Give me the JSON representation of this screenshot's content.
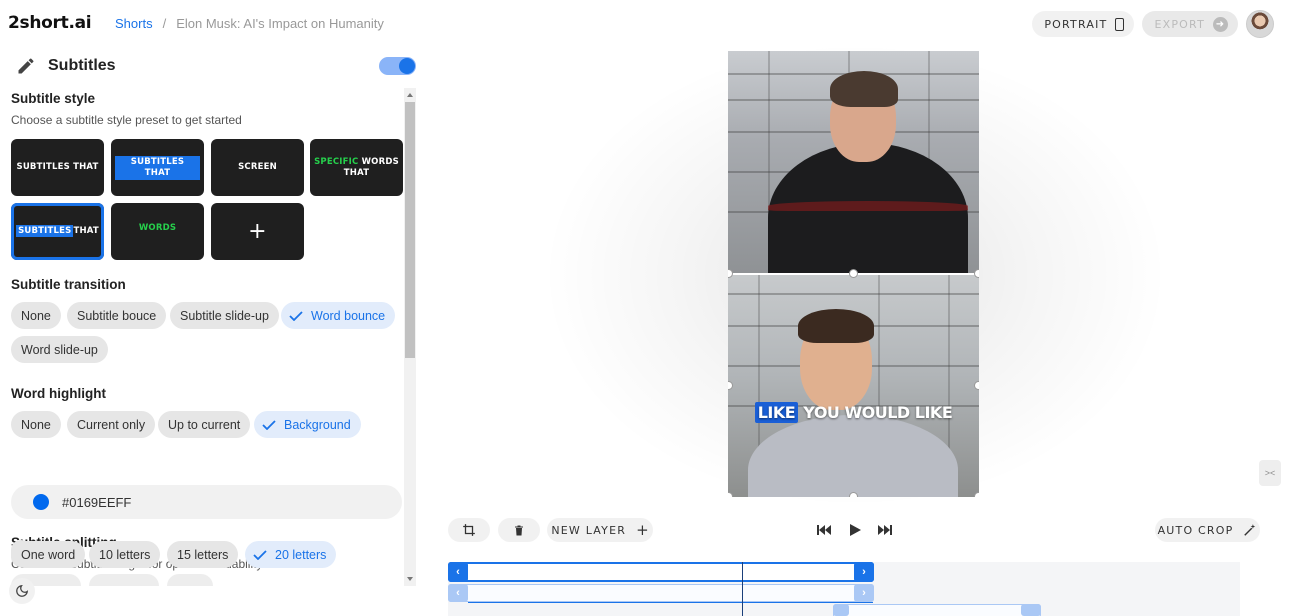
{
  "header": {
    "logo": "2short.ai",
    "breadcrumb": {
      "parent": "Shorts",
      "separator": "/",
      "current": "Elon Musk: AI's Impact on Humanity"
    },
    "portrait_label": "PORTRAIT",
    "export_label": "EXPORT"
  },
  "panel": {
    "title": "Subtitles",
    "toggle_on": true,
    "style": {
      "title": "Subtitle style",
      "subtitle": "Choose a subtitle style preset to get started",
      "presets": [
        {
          "text": "SUBTITLES THAT"
        },
        {
          "text": "SUBTITLES THAT"
        },
        {
          "text": "SCREEN"
        },
        {
          "highlight": "SPECIFIC",
          "text": "WORDS THAT"
        },
        {
          "highlight": "SUBTITLES",
          "text": "THAT",
          "selected": true
        },
        {
          "text": "WORDS"
        },
        {
          "text": "+"
        }
      ]
    },
    "transition": {
      "title": "Subtitle transition",
      "options": [
        "None",
        "Subtitle bouce",
        "Subtitle slide-up",
        "Word bounce",
        "Word slide-up"
      ],
      "selected": "Word bounce"
    },
    "highlight": {
      "title": "Word highlight",
      "options": [
        "None",
        "Current only",
        "Up to current",
        "Background"
      ],
      "selected": "Background",
      "color_value": "#0169EEFF",
      "color": "#0169EE"
    },
    "splitting": {
      "title": "Subtitle splitting",
      "subtitle": "Customize subtitle length for optimal readability",
      "options": [
        "One word",
        "10 letters",
        "15 letters",
        "20 letters"
      ],
      "selected": "20 letters"
    }
  },
  "preview": {
    "caption_highlight": "LIKE",
    "caption_rest": "YOU WOULD LIKE"
  },
  "controls": {
    "new_layer_label": "NEW LAYER",
    "auto_crop_label": "AUTO CROP"
  },
  "colors": {
    "accent": "#1a73e8",
    "chip_bg": "#e6e6e6",
    "preset_bg": "#1f1f1f"
  }
}
